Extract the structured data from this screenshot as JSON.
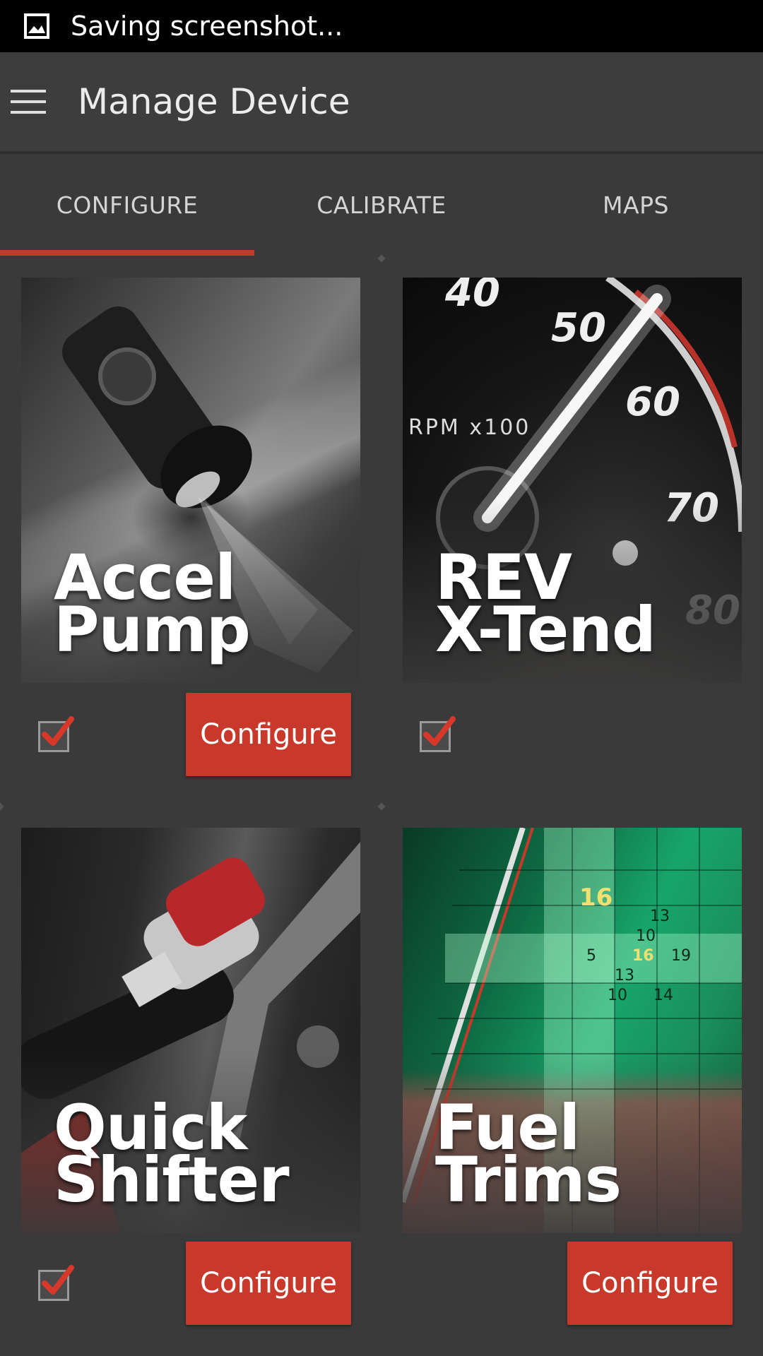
{
  "status_bar": {
    "icon": "gallery-icon",
    "text": "Saving screenshot..."
  },
  "app_bar": {
    "menu_icon": "hamburger-menu-icon",
    "title": "Manage Device"
  },
  "tabs": [
    {
      "label": "CONFIGURE",
      "active": true
    },
    {
      "label": "CALIBRATE",
      "active": false
    },
    {
      "label": "MAPS",
      "active": false
    }
  ],
  "cards": [
    {
      "title_line1": "Accel",
      "title_line2": "Pump",
      "checked": true,
      "has_configure": true,
      "button_label": "Configure"
    },
    {
      "title_line1": "REV",
      "title_line2": "X-Tend",
      "checked": true,
      "has_configure": false,
      "button_label": ""
    },
    {
      "title_line1": "Quick",
      "title_line2": "Shifter",
      "checked": true,
      "has_configure": true,
      "button_label": "Configure"
    },
    {
      "title_line1": "Fuel",
      "title_line2": "Trims",
      "checked": false,
      "has_configure": true,
      "button_label": "Configure"
    }
  ],
  "rev_gauge": {
    "labels": [
      "40",
      "50",
      "60",
      "70",
      "80",
      "RPM x100"
    ]
  },
  "fuel_table": {
    "labels": [
      "16",
      "13",
      "10",
      "16",
      "19",
      "13",
      "10",
      "14",
      "5"
    ]
  },
  "colors": {
    "accent": "#c8392b",
    "background": "#3a3a3a",
    "status_bar": "#000000"
  }
}
